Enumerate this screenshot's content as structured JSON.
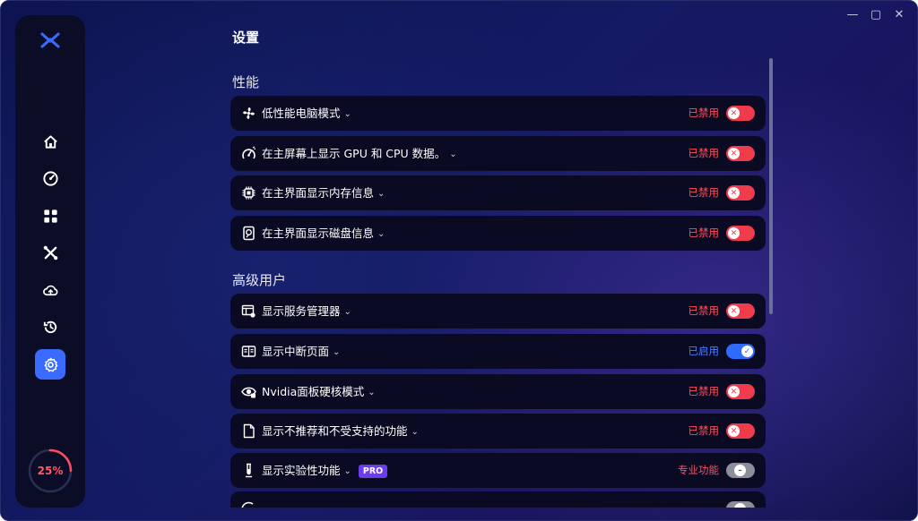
{
  "window": {
    "controls": {
      "minimize": "—",
      "maximize": "▢",
      "close": "✕"
    }
  },
  "sidebar": {
    "logo_icon": "x-logo-icon",
    "items": [
      {
        "icon": "home-icon",
        "active": false
      },
      {
        "icon": "speedometer-icon",
        "active": false
      },
      {
        "icon": "apps-grid-icon",
        "active": false
      },
      {
        "icon": "x-tools-icon",
        "active": false
      },
      {
        "icon": "cloud-upload-icon",
        "active": false
      },
      {
        "icon": "history-icon",
        "active": false
      },
      {
        "icon": "gear-icon",
        "active": true
      }
    ],
    "usage_percent": 25,
    "usage_text": "25%"
  },
  "page": {
    "title": "设置",
    "sections": {
      "performance": "性能",
      "advanced": "高级用户"
    }
  },
  "rows": [
    {
      "icon": "fan-icon",
      "label": "低性能电脑模式",
      "status": "已禁用",
      "state": "off"
    },
    {
      "icon": "gauge-icon",
      "label": "在主屏幕上显示 GPU 和 CPU 数据。",
      "status": "已禁用",
      "state": "off"
    },
    {
      "icon": "chip-icon",
      "label": "在主界面显示内存信息",
      "status": "已禁用",
      "state": "off"
    },
    {
      "icon": "disk-icon",
      "label": "在主界面显示磁盘信息",
      "status": "已禁用",
      "state": "off"
    },
    {
      "icon": "services-icon",
      "label": "显示服务管理器",
      "status": "已禁用",
      "state": "off"
    },
    {
      "icon": "layout-icon",
      "label": "显示中断页面",
      "status": "已启用",
      "state": "on"
    },
    {
      "icon": "eye-icon",
      "label": "Nvidia面板硬核模式",
      "status": "已禁用",
      "state": "off"
    },
    {
      "icon": "file-icon",
      "label": "显示不推荐和不受支持的功能",
      "status": "已禁用",
      "state": "off"
    },
    {
      "icon": "flask-icon",
      "label": "显示实验性功能",
      "badge": "PRO",
      "status": "专业功能",
      "state": "disabled"
    },
    {
      "icon": "partial-icon",
      "label": "",
      "badge": "",
      "status": "",
      "state": "disabled"
    }
  ],
  "colors": {
    "accent": "#3a6bff",
    "disabled_red": "#ef3b4c",
    "enabled_blue": "#2f6bff",
    "pro_purple": "#6b3cf0"
  }
}
